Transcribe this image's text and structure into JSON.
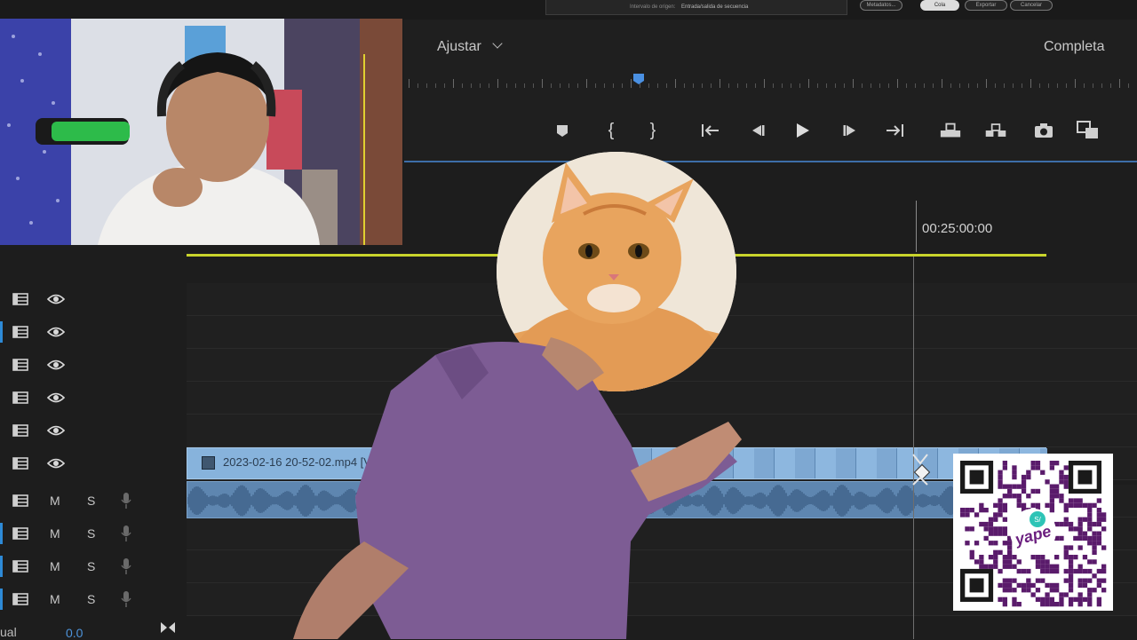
{
  "source_bar": {
    "label": "Intervalo de origen:",
    "value": "Entrada/salida de secuencia",
    "buttons": [
      "Metadatos...",
      "Cola",
      "Exportar",
      "Cancelar"
    ]
  },
  "monitor": {
    "fit_dropdown": "Ajustar",
    "quality_dropdown": "Completa",
    "controls": [
      {
        "name": "add-marker-icon",
        "glyph": "⛊"
      },
      {
        "name": "mark-in-icon",
        "glyph": "{"
      },
      {
        "name": "mark-out-icon",
        "glyph": "}"
      },
      {
        "name": "go-to-in-icon",
        "glyph": "{←"
      },
      {
        "name": "step-back-icon",
        "glyph": "◀|"
      },
      {
        "name": "play-icon",
        "glyph": "▶"
      },
      {
        "name": "step-forward-icon",
        "glyph": "|▶"
      },
      {
        "name": "go-to-out-icon",
        "glyph": "→}"
      },
      {
        "name": "lift-icon",
        "glyph": "⏏"
      },
      {
        "name": "extract-icon",
        "glyph": "⏏"
      },
      {
        "name": "export-frame-icon",
        "glyph": "📷"
      },
      {
        "name": "compare-view-icon",
        "glyph": "⧉"
      }
    ]
  },
  "timeline": {
    "timecode": "00:25:00:00",
    "clip_label": "2023-02-16 20-52-02.mp4 [V]",
    "video_tracks": 6,
    "audio_tracks": 4,
    "track_m_label": "M",
    "track_s_label": "S",
    "bottom_label": "ual",
    "bottom_value": "0.0"
  },
  "colors": {
    "accent_blue": "#2d8ad6",
    "work_area": "#c9d42c",
    "clip_video": "#87b3dc",
    "clip_audio": "#5e86b0"
  },
  "overlays": {
    "qr_brand": "yape",
    "qr_symbol": "S/"
  }
}
